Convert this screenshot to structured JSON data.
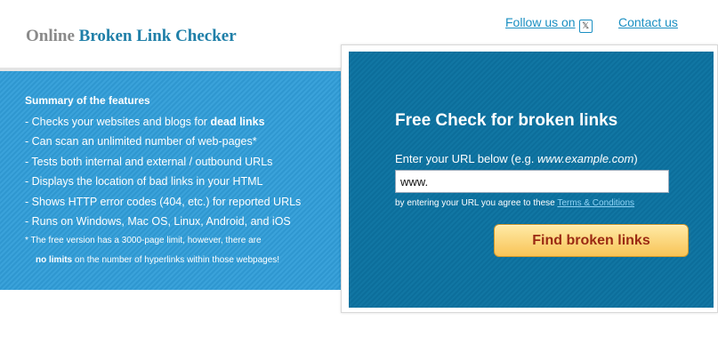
{
  "brand": {
    "part1": "Online",
    "part2": "Broken Link Checker"
  },
  "topnav": {
    "follow_label": "Follow us on",
    "follow_icon": "x-icon",
    "contact_label": "Contact us"
  },
  "features": {
    "title": "Summary of the features",
    "items": [
      {
        "pre": "- Checks your websites and blogs for ",
        "bold": "dead links"
      },
      {
        "pre": "- Can scan an unlimited number of web-pages*"
      },
      {
        "pre": "- Tests both internal and external / outbound URLs"
      },
      {
        "pre": "- Displays the location of bad links in your HTML"
      },
      {
        "pre": "- Shows HTTP error codes (404, etc.) for reported URLs"
      },
      {
        "pre": "- Runs on Windows, Mac OS, Linux, Android, and iOS"
      }
    ],
    "note_line1": "*  The free version has a 3000-page limit, however, there are",
    "note_line2_bold": "no limits",
    "note_line2_rest": " on the number of hyperlinks within those webpages!"
  },
  "form": {
    "title": "Free Check for broken links",
    "label_pre": "Enter your URL below (e.g. ",
    "label_example": "www.example.com",
    "label_post": ")",
    "url_value": "www.",
    "terms_pre": "by entering your URL you agree to these ",
    "terms_link": "Terms & Conditions",
    "button_label": "Find broken links"
  },
  "colors": {
    "left_panel": "#2f97d0",
    "right_panel": "#0c6e9b",
    "brand_blue": "#1f7fa8",
    "button": "#f8c457"
  }
}
